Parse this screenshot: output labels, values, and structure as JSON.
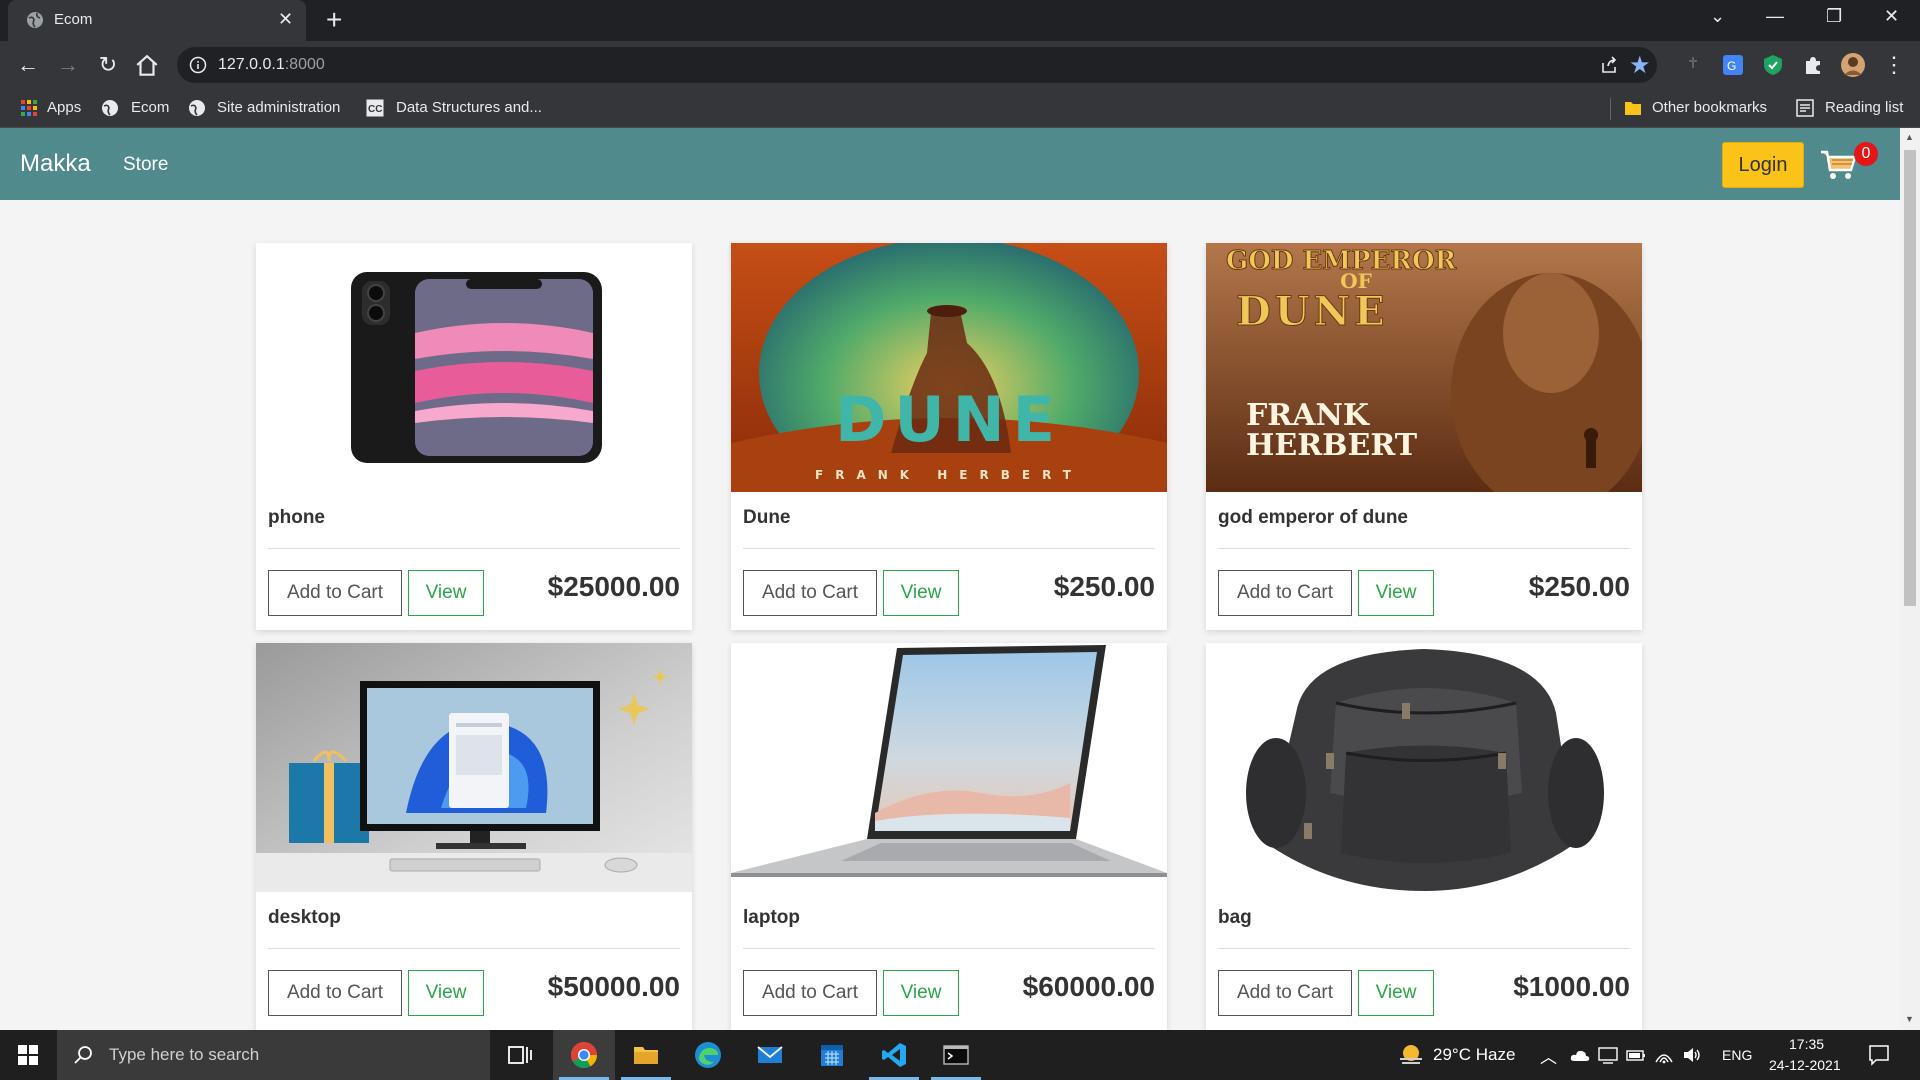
{
  "browser": {
    "tab_title": "Ecom",
    "url_host": "127.0.0.1",
    "url_port": ":8000",
    "bookmarks": [
      "Apps",
      "Ecom",
      "Site administration",
      "Data Structures and..."
    ],
    "other_bookmarks": "Other bookmarks",
    "reading_list": "Reading list"
  },
  "site": {
    "brand": "Makka",
    "nav_store": "Store",
    "login_label": "Login",
    "cart_count": "0"
  },
  "products": [
    {
      "name": "phone",
      "price": "$25000.00",
      "add_label": "Add to Cart",
      "view_label": "View",
      "image": "phone"
    },
    {
      "name": "Dune",
      "price": "$250.00",
      "add_label": "Add to Cart",
      "view_label": "View",
      "image": "dune-cover",
      "cover_title": "DUNE",
      "cover_author": "FRANK HERBERT"
    },
    {
      "name": "god emperor of dune",
      "price": "$250.00",
      "add_label": "Add to Cart",
      "view_label": "View",
      "image": "god-emperor-cover",
      "cover_title_line1": "GOD EMPEROR",
      "cover_title_line2": "OF",
      "cover_title_line3": "DUNE",
      "cover_author_line1": "FRANK",
      "cover_author_line2": "HERBERT"
    },
    {
      "name": "desktop",
      "price": "$50000.00",
      "add_label": "Add to Cart",
      "view_label": "View",
      "image": "desktop"
    },
    {
      "name": "laptop",
      "price": "$60000.00",
      "add_label": "Add to Cart",
      "view_label": "View",
      "image": "laptop"
    },
    {
      "name": "bag",
      "price": "$1000.00",
      "add_label": "Add to Cart",
      "view_label": "View",
      "image": "bag"
    }
  ],
  "taskbar": {
    "search_placeholder": "Type here to search",
    "weather": "29°C  Haze",
    "language": "ENG",
    "time": "17:35",
    "date": "24-12-2021"
  },
  "colors": {
    "navbar": "#508a8c",
    "login": "#fbc318",
    "view_green": "#28a745",
    "badge_red": "#e41616"
  }
}
